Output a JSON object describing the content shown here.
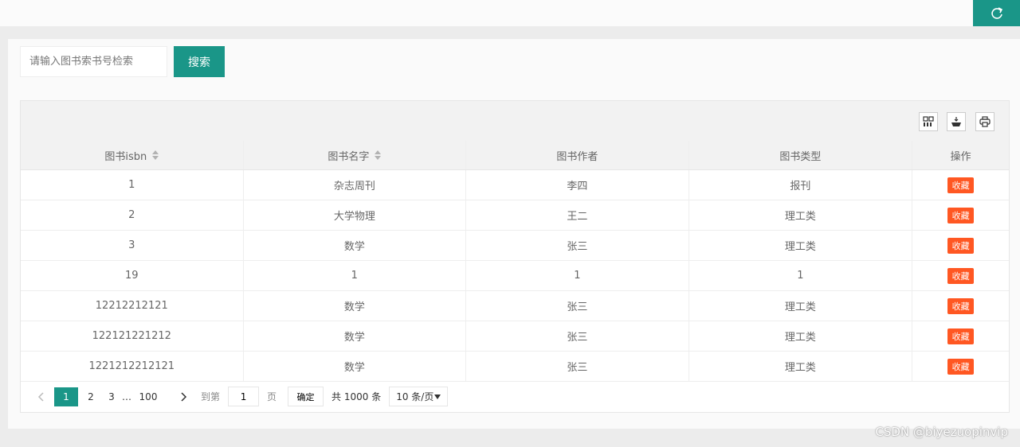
{
  "search": {
    "placeholder": "请输入图书索书号检索",
    "button_label": "搜索"
  },
  "table": {
    "columns": [
      "图书isbn",
      "图书名字",
      "图书作者",
      "图书类型",
      "操作"
    ],
    "rows": [
      {
        "isbn": "1",
        "name": "杂志周刊",
        "author": "李四",
        "type": "报刊",
        "action": "收藏"
      },
      {
        "isbn": "2",
        "name": "大学物理",
        "author": "王二",
        "type": "理工类",
        "action": "收藏"
      },
      {
        "isbn": "3",
        "name": "数学",
        "author": "张三",
        "type": "理工类",
        "action": "收藏"
      },
      {
        "isbn": "19",
        "name": "1",
        "author": "1",
        "type": "1",
        "action": "收藏"
      },
      {
        "isbn": "12212212121",
        "name": "数学",
        "author": "张三",
        "type": "理工类",
        "action": "收藏"
      },
      {
        "isbn": "122121221212",
        "name": "数学",
        "author": "张三",
        "type": "理工类",
        "action": "收藏"
      },
      {
        "isbn": "1221212212121",
        "name": "数学",
        "author": "张三",
        "type": "理工类",
        "action": "收藏"
      }
    ]
  },
  "pager": {
    "pages": [
      "1",
      "2",
      "3"
    ],
    "ellipsis": "…",
    "last_page": "100",
    "goto_label": "到第",
    "page_value": "1",
    "page_unit": "页",
    "confirm_label": "确定",
    "total_label": "共 1000 条",
    "page_size_label": "10 条/页"
  },
  "watermark": "CSDN @biyezuopinvip",
  "icons": [
    "refresh-icon",
    "columns-icon",
    "export-icon",
    "print-icon",
    "chevron-left-icon",
    "chevron-right-icon",
    "sort-icon",
    "caret-down-icon"
  ],
  "colors": {
    "primary": "#1a9688",
    "danger": "#ff5722"
  }
}
